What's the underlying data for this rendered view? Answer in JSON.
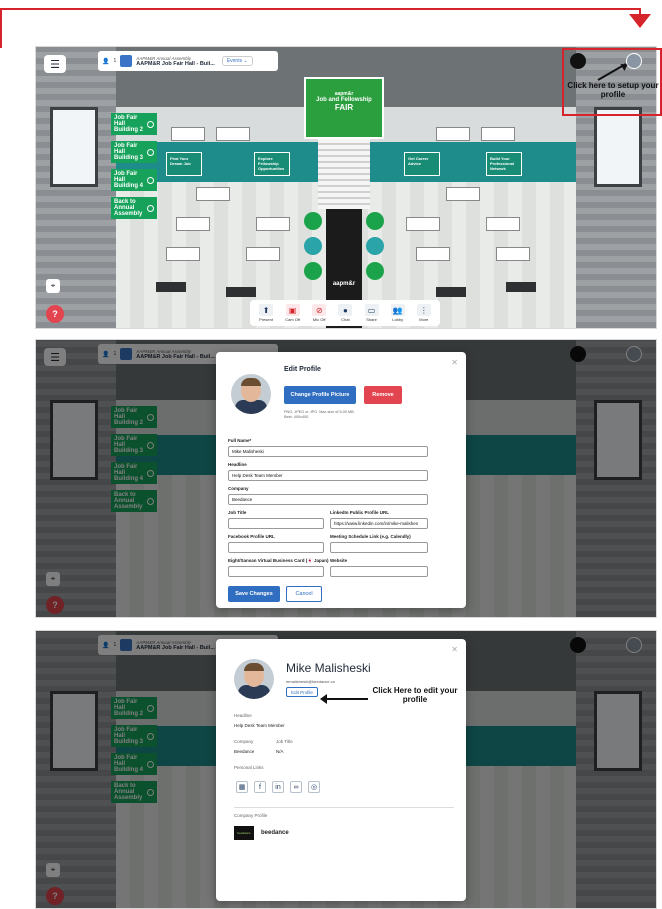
{
  "topbar": {
    "menu_icon": "hamburger-icon",
    "user_count": "1",
    "event_subtitle": "AAPM&R Annual Assembly",
    "location_title": "AAPM&R Job Fair Hall - Buil...",
    "events_label": "Events"
  },
  "scene": {
    "stage_sign_line1": "aapm&r",
    "stage_sign_line2": "Job and Fellowship",
    "stage_sign_line3": "FAIR",
    "floor_logo": "aapm&r",
    "signs": [
      "Exhibitor Directory",
      "Find Your Dream Job",
      "Explore Fellowship Opportunities",
      "Get Career Advice",
      "Build Your Professional Network"
    ]
  },
  "sidenav": {
    "items": [
      "Job Fair Hall Building 2",
      "Job Fair Hall Building 3",
      "Job Fair Hall Building 4",
      "Back to Annual Assembly"
    ]
  },
  "toolbar": {
    "items": [
      {
        "label": "Present",
        "icon": "present-icon"
      },
      {
        "label": "Cam Off",
        "icon": "camera-off-icon"
      },
      {
        "label": "Mic Off",
        "icon": "mic-off-icon"
      },
      {
        "label": "Chat",
        "icon": "chat-icon"
      },
      {
        "label": "Share",
        "icon": "share-screen-icon"
      },
      {
        "label": "Lobby",
        "icon": "lobby-icon"
      },
      {
        "label": "More",
        "icon": "more-icon"
      }
    ]
  },
  "annotations": {
    "setup_profile": "Click here to setup your profile",
    "edit_profile": "Click Here to edit your profile"
  },
  "edit_profile": {
    "title": "Edit Profile",
    "change_picture": "Change Profile Picture",
    "remove": "Remove",
    "note": "PNG, JPEG or JPG. Max size of 5.00 MB. Best: 400x400.",
    "full_name_label": "Full Name*",
    "full_name": "Mike Malisheski",
    "headline_label": "Headline",
    "headline": "Help Desk Team Member",
    "company_label": "Company",
    "company": "Beedance",
    "job_title_label": "Job Title",
    "job_title": "",
    "linkedin_label": "LinkedIn Public Profile URL",
    "linkedin": "https://www.linkedin.com/in/mike-malishes",
    "facebook_label": "Facebook Profile URL",
    "facebook": "",
    "meeting_label": "Meeting Schedule Link (e.g. Calendly)",
    "meeting": "",
    "eight_label": "Eight/Sansan Virtual Business Card (🇯🇵 Japan)",
    "eight": "",
    "website_label": "Website",
    "website": "",
    "save": "Save Changes",
    "cancel": "Cancel"
  },
  "profile_view": {
    "name": "Mike Malisheski",
    "email": "mmalisheski@beedance.co",
    "edit_button": "Edit Profile",
    "headline_label": "Headline",
    "headline": "Help Desk Team Member",
    "company_label": "Company",
    "company": "Beedance",
    "job_title_label": "Job Title",
    "job_title": "N/A",
    "links_label": "Personal Links",
    "company_profile_label": "Company Profile",
    "company_name": "beedance",
    "company_logo_text": "beedance"
  }
}
